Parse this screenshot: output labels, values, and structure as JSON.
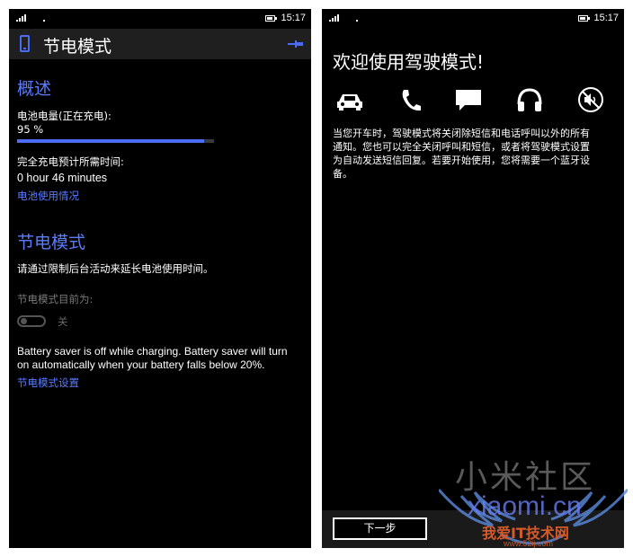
{
  "left": {
    "status": {
      "time": "15:17"
    },
    "header": {
      "title": "节电模式"
    },
    "overview": {
      "title": "概述",
      "battery_label": "电池电量(正在充电):",
      "battery_value": "95 %",
      "battery_level": 0.95,
      "charge_time_label": "完全充电预计所需时间:",
      "charge_time_value": "0 hour 46 minutes",
      "usage_link": "电池使用情况"
    },
    "saver": {
      "title": "节电模式",
      "description": "请通过限制后台活动来延长电池使用时间。",
      "current_label": "节电模式目前为:",
      "toggle_state": "关",
      "note_line1": "Battery saver is off while charging. Battery saver will turn",
      "note_line2": "on automatically when your battery falls below 20%.",
      "settings_link": "节电模式设置"
    }
  },
  "right": {
    "status": {
      "time": "15:17"
    },
    "welcome": "欢迎使用驾驶模式!",
    "icons": [
      "car-icon",
      "phone-call-icon",
      "message-icon",
      "headphones-icon",
      "mute-icon"
    ],
    "desc_line1": "当您开车时，驾驶模式将关闭除短信和电话呼叫以外的所有",
    "desc_line2": "通知。您也可以完全关闭呼叫和短信，或者将驾驶模式设置",
    "desc_line3": "为自动发送短信回复。若要开始使用，您将需要一个蓝牙设",
    "desc_line4": "备。",
    "next_button": "下一步"
  },
  "watermark": {
    "line1": "小米社区",
    "line2": "xiaomi.cn",
    "line3": "我爱IT技术网",
    "line4": "www.52ij.com"
  },
  "colors": {
    "accent": "#4a6cf7",
    "background": "#000000",
    "header": "#1f1f1f"
  }
}
